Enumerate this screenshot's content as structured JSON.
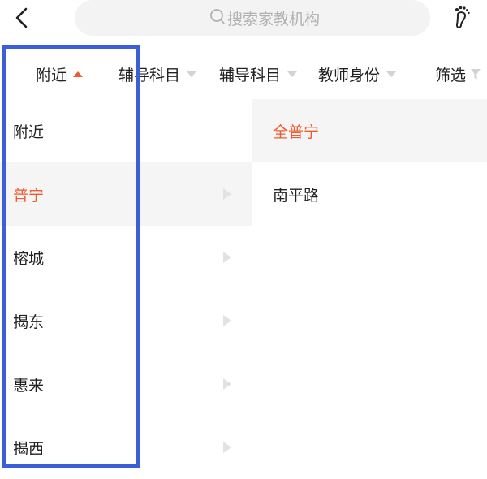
{
  "header": {
    "search_placeholder": "搜索家教机构",
    "icons": {
      "back": "chevron-left-icon",
      "search": "search-icon",
      "footprint": "footprint-icon"
    }
  },
  "filter_bar": {
    "items": [
      {
        "label": "附近",
        "state": "active"
      },
      {
        "label": "辅导科目",
        "state": "collapsed"
      },
      {
        "label": "辅导科目",
        "state": "collapsed"
      },
      {
        "label": "教师身份",
        "state": "collapsed"
      },
      {
        "label": "筛选",
        "state": "collapsed"
      }
    ]
  },
  "regions": [
    {
      "label": "附近"
    },
    {
      "label": "普宁"
    },
    {
      "label": "榕城"
    },
    {
      "label": "揭东"
    },
    {
      "label": "惠来"
    },
    {
      "label": "揭西"
    }
  ],
  "selected_region": "普宁",
  "sub_regions": [
    {
      "label": "全普宁"
    },
    {
      "label": "南平路"
    }
  ],
  "selected_sub_region": "全普宁",
  "colors": {
    "accent": "#ef5b2e",
    "highlight_frame": "#3a5fd9",
    "selected_row_bg": "#f5f5f5",
    "search_bg": "#f3f3f3"
  }
}
